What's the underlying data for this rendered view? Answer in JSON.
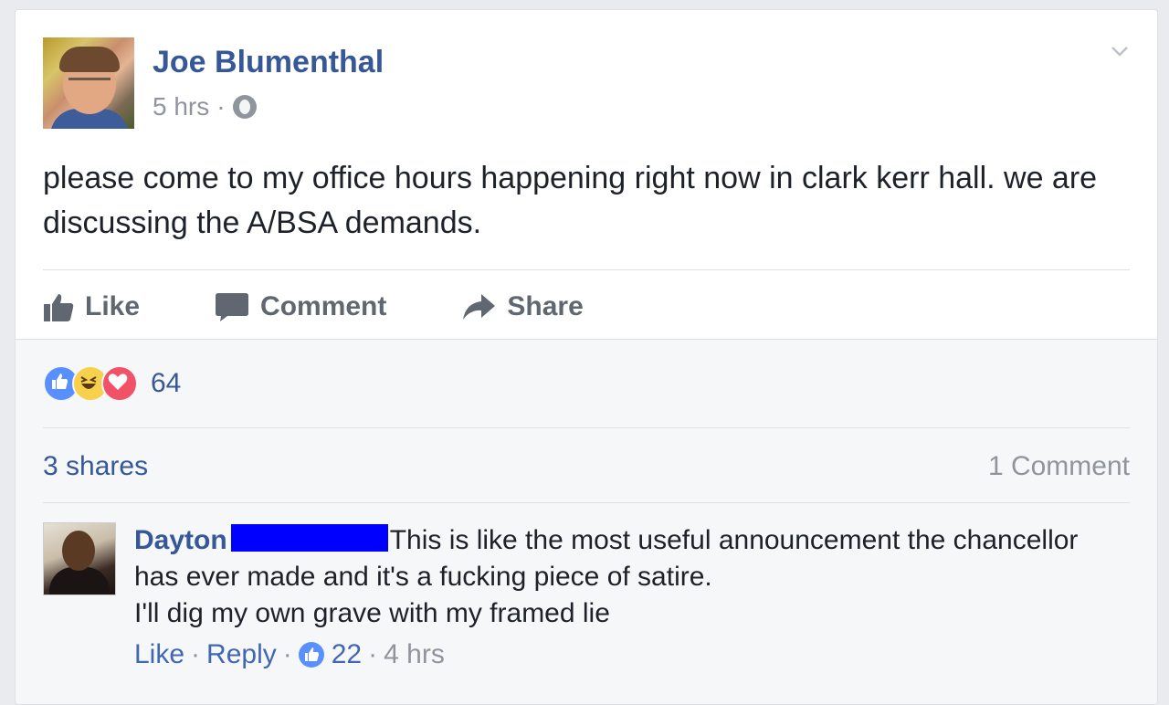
{
  "post": {
    "author": "Joe Blumenthal",
    "time": "5 hrs",
    "dot": "·",
    "text": "please come to my office hours happening right now in clark kerr hall. we are discussing the A/BSA demands.",
    "actions": {
      "like": "Like",
      "comment": "Comment",
      "share": "Share"
    }
  },
  "stats": {
    "reactions": [
      "like-reaction",
      "haha-reaction",
      "love-reaction"
    ],
    "reaction_count": "64",
    "shares": "3 shares",
    "comment_count": "1 Comment"
  },
  "comment": {
    "name": "Dayton",
    "text_line1": "This is like the most useful announcement the chancellor has ever made and it's a fucking piece of satire.",
    "text_line2": "I'll dig my own grave with my framed lie",
    "like": "Like",
    "reply": "Reply",
    "likes": "22",
    "time": "4 hrs"
  },
  "colors": {
    "link": "#365899",
    "muted": "#90949c",
    "like_blue": "#5890ff",
    "love_red": "#f25268",
    "haha_yellow": "#f7d14c",
    "redaction": "#0000ff"
  }
}
